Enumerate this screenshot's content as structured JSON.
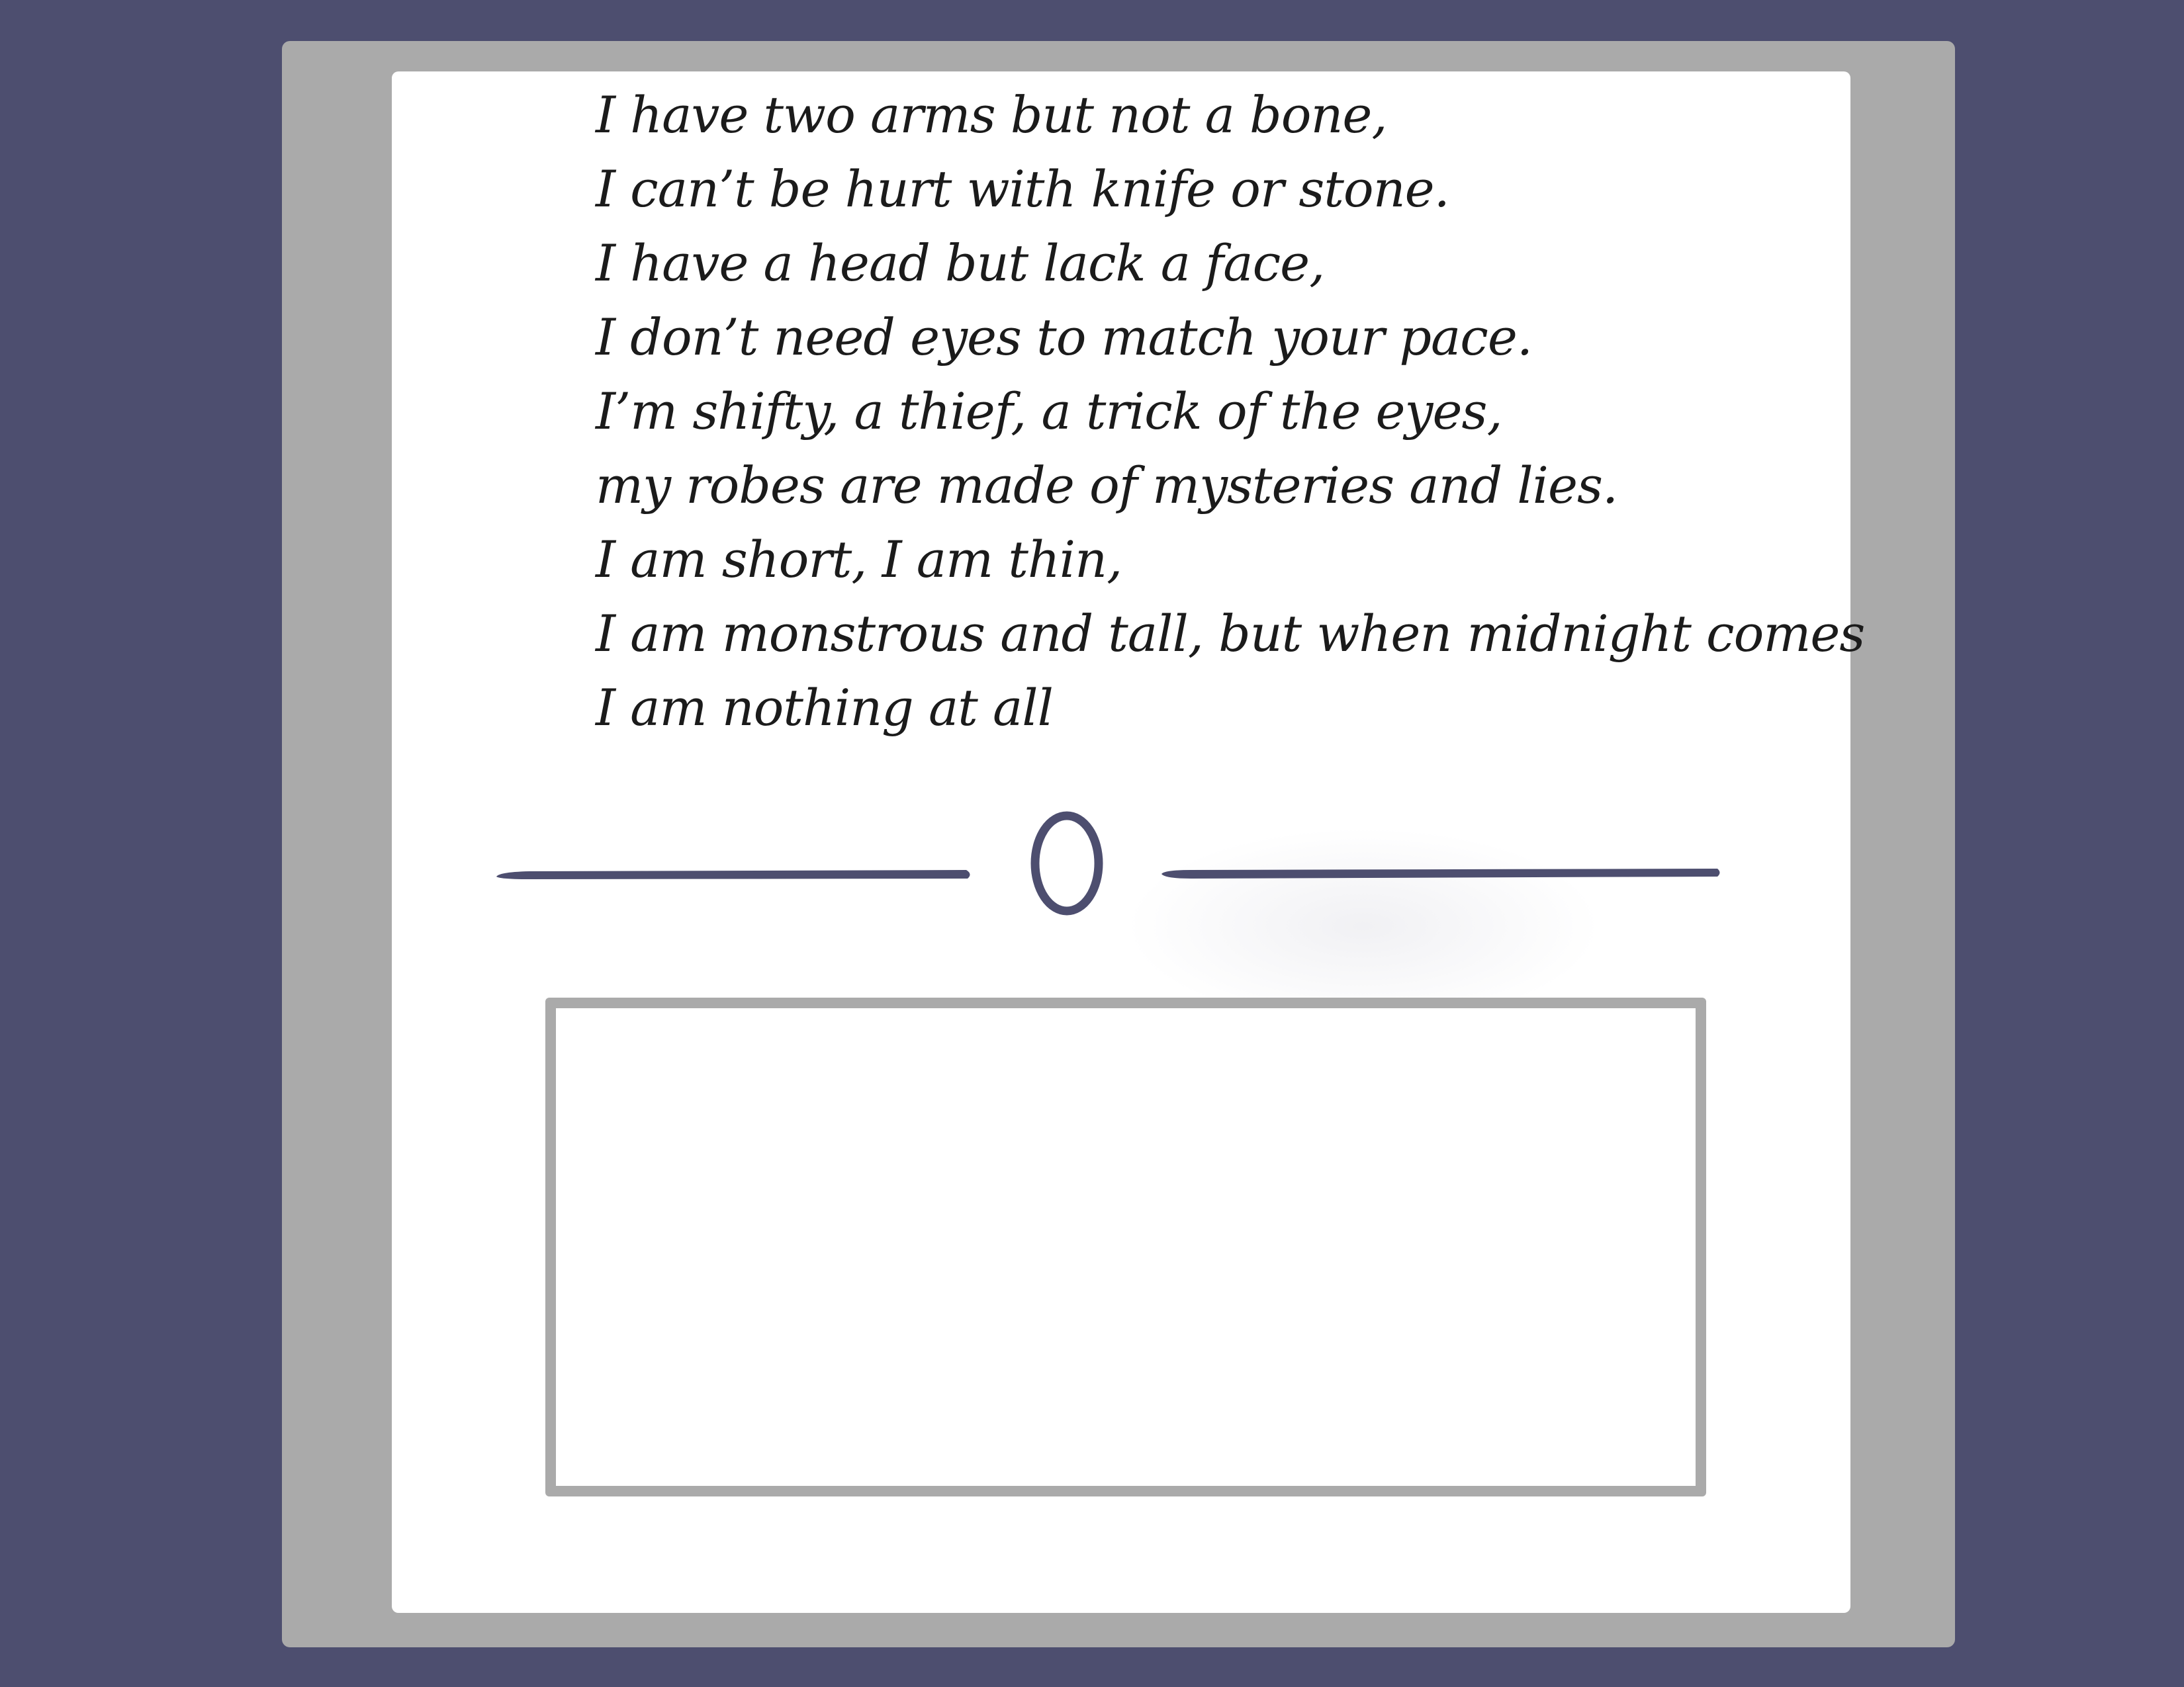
{
  "riddle": {
    "lines": [
      "I have two arms but not a bone,",
      "I can’t be hurt with knife or stone.",
      "I have a head but lack a face,",
      "I don’t need eyes to match your pace.",
      "I’m shifty, a thief, a trick of the eyes,",
      "my robes are made of mysteries and lies.",
      "I am short, I am thin,",
      "I am monstrous and tall, but when midnight comes",
      "I am nothing at all"
    ]
  },
  "divider": {
    "ornament_icon": "oval-ring-icon"
  },
  "answer_box": {
    "value": ""
  },
  "colors": {
    "background": "#4d4e6f",
    "frame": "#aaaaaa",
    "card": "#ffffff",
    "accent": "#4d4e6f",
    "text": "#1b1b1b"
  }
}
